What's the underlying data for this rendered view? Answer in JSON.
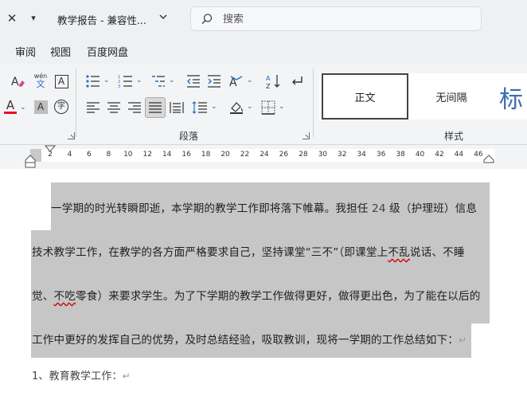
{
  "titlebar": {
    "title": "教学报告 - 兼容性...",
    "search_placeholder": "搜索"
  },
  "menu": {
    "tabs": [
      "审阅",
      "视图",
      "百度网盘"
    ]
  },
  "ribbon": {
    "paragraph_group_label": "段落",
    "styles_group_label": "样式",
    "phonetic_label": "wén",
    "phonetic_char": "文",
    "char_border_label": "A",
    "font_color_label": "A",
    "char_shading_label": "A",
    "enclosed_char_label": "字",
    "styles": {
      "normal": "正文",
      "no_spacing": "无间隔",
      "heading": "标"
    },
    "colors": {
      "font_color_bar": "#e81123",
      "heading_color": "#3b6db3"
    }
  },
  "ruler": {
    "ticks": [
      "2",
      "4",
      "6",
      "8",
      "10",
      "12",
      "14",
      "16",
      "18",
      "20",
      "22",
      "24",
      "26",
      "28",
      "30",
      "32",
      "34",
      "36",
      "38",
      "40",
      "42",
      "44",
      "46"
    ]
  },
  "document": {
    "paragraph1": {
      "line1_a": "一学期的时光转瞬即逝，本学期的教学工作即将落下帷幕。我担任 ",
      "line1_num": "24",
      "line1_b": " 级（护理班）信息",
      "line2_a": "技术教学工作，在教学的各方面严格要求自己，坚持课堂“三不”（即课堂上",
      "line2_sq": "不乱",
      "line2_b": "说话、不睡",
      "line3_a": "觉、",
      "line3_sq": "不吃",
      "line3_b": "零食）来要求学生。为了下学期的教学工作做得更好，做得更出色，为了能在以后的",
      "line4": "工作中更好的发挥自己的优势，及时总结经验，吸取教训，现将一学期的工作总结如下："
    },
    "heading1": "1、教育教学工作：",
    "paragraph_mark": "↵"
  }
}
